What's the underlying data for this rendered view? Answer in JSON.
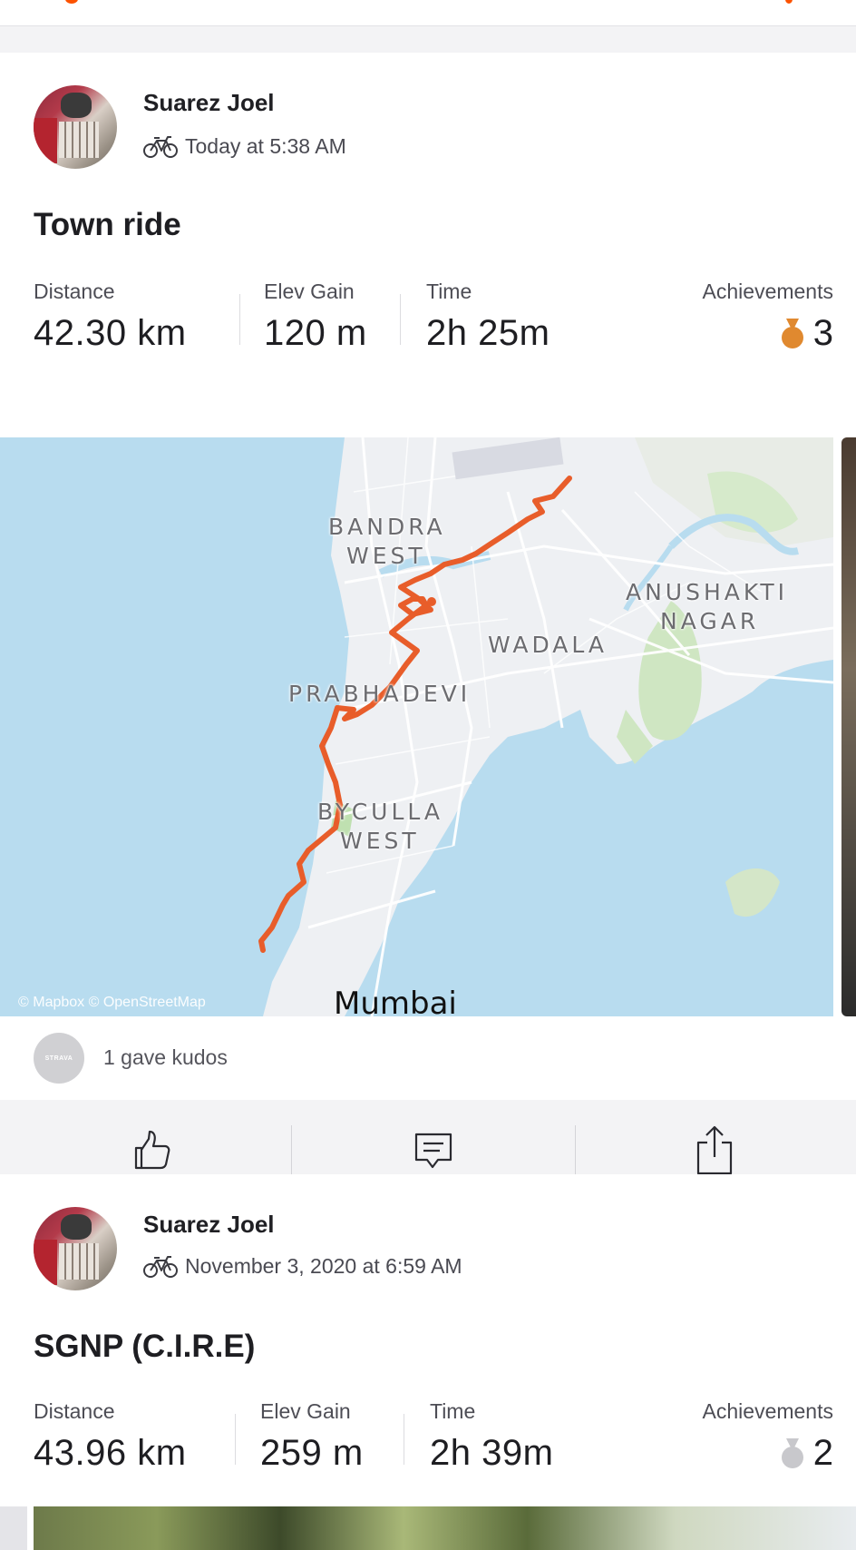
{
  "feed": {
    "activities": [
      {
        "athlete": "Suarez Joel",
        "timestamp": "Today at 5:38 AM",
        "sport_icon": "bike-icon",
        "title": "Town ride",
        "stats": [
          {
            "label": "Distance",
            "value": "42.30 km"
          },
          {
            "label": "Elev Gain",
            "value": "120 m"
          },
          {
            "label": "Time",
            "value": "2h 25m"
          }
        ],
        "achievements": {
          "label": "Achievements",
          "count": "3",
          "medal_color": "#e0892f"
        },
        "map": {
          "labels": {
            "bandra": "BANDRA",
            "bandra2": "WEST",
            "anushakti": "ANUSHAKTI",
            "anushakti2": "NAGAR",
            "wadala": "WADALA",
            "prabhadevi": "PRABHADEVI",
            "byculla": "BYCULLA",
            "byculla2": "WEST",
            "city": "Mumbai"
          },
          "attribution": "© Mapbox © OpenStreetMap",
          "route_color": "#e85d2a"
        },
        "kudos": {
          "text": "1 gave kudos",
          "avatar_text": "STRAVA"
        }
      },
      {
        "athlete": "Suarez Joel",
        "timestamp": "November 3, 2020 at 6:59 AM",
        "sport_icon": "bike-icon",
        "title": "SGNP (C.I.R.E)",
        "stats": [
          {
            "label": "Distance",
            "value": "43.96 km"
          },
          {
            "label": "Elev Gain",
            "value": "259 m"
          },
          {
            "label": "Time",
            "value": "2h 39m"
          }
        ],
        "achievements": {
          "label": "Achievements",
          "count": "2",
          "medal_color": "#c8c8cc"
        }
      }
    ]
  },
  "actions": {
    "like_icon": "thumbs-up-icon",
    "comment_icon": "comment-icon",
    "share_icon": "share-icon"
  },
  "colors": {
    "brand": "#fc5200",
    "map_water": "#b8dcef",
    "map_land": "#eef0f3",
    "map_park": "#cfe6c2"
  }
}
